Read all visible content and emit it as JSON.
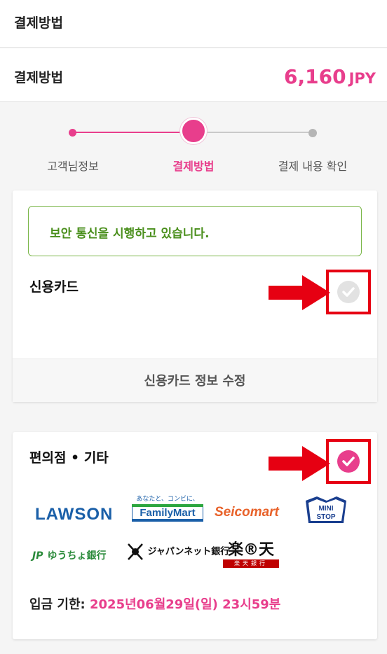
{
  "header": {
    "title": "결제방법"
  },
  "payment": {
    "label": "결제방법",
    "amount": "6,160",
    "currency": "JPY"
  },
  "steps": [
    {
      "label": "고객님정보",
      "state": "done"
    },
    {
      "label": "결제방법",
      "state": "current"
    },
    {
      "label": "결제 내용 확인",
      "state": "todo"
    }
  ],
  "credit_card": {
    "secure_message": "보안 통신을 시행하고 있습니다.",
    "title": "신용카드",
    "selected": false,
    "edit_label": "신용카드 정보 수정"
  },
  "convenience": {
    "title": "편의점 • 기타",
    "selected": true,
    "logos": {
      "lawson": "LAWSON",
      "familymart_tag": "あなたと、コンビに、",
      "familymart": "FamilyMart",
      "seicomart": "Seicomart",
      "ministop": "MINI STOP",
      "japanpost": "ゆうちょ銀行",
      "japannet": "ジャパンネット銀行",
      "rakuten_top": "楽®天",
      "rakuten_bottom": "楽天銀行"
    },
    "deadline_label": "입금 기한:",
    "deadline_value": "2025년06월29일(일) 23시59분"
  },
  "colors": {
    "accent": "#e83e8c",
    "secure_green": "#4a8f1c",
    "highlight_red": "#e60012"
  },
  "icons": {
    "check": "check-circle-icon",
    "arrow": "arrow-right-icon"
  }
}
